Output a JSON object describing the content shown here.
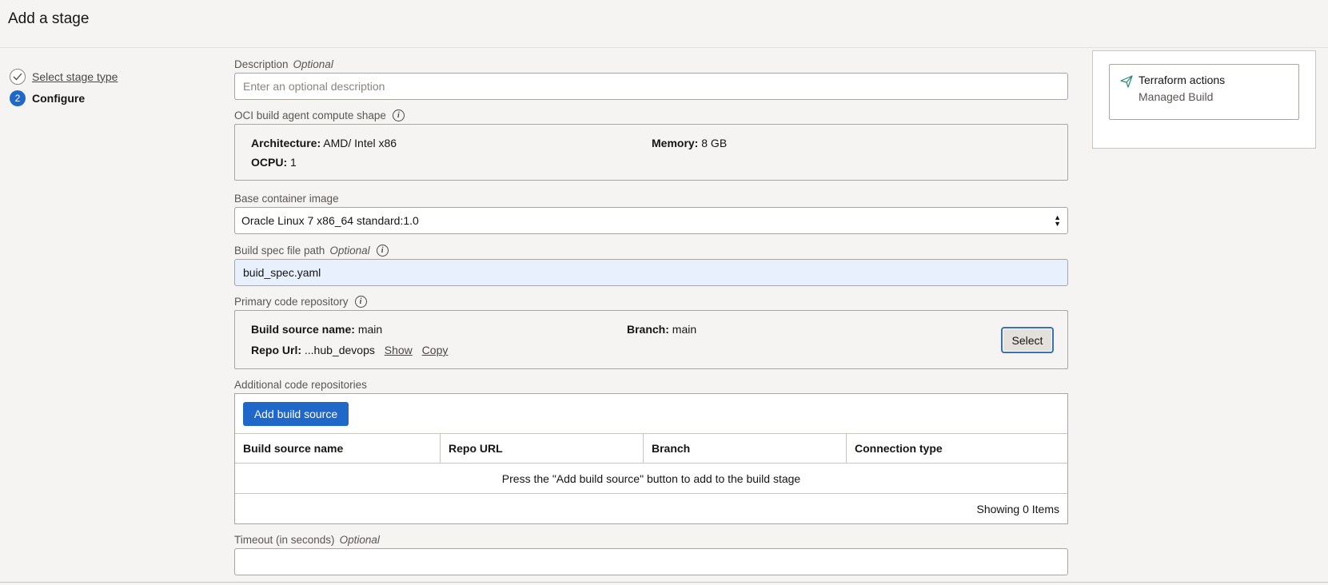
{
  "header": {
    "title": "Add a stage"
  },
  "steps": [
    {
      "number": "",
      "label": "Select stage type"
    },
    {
      "number": "2",
      "label": "Configure"
    }
  ],
  "form": {
    "description": {
      "label": "Description",
      "optional": "Optional",
      "placeholder": "Enter an optional description"
    },
    "compute_shape": {
      "label": "OCI build agent compute shape",
      "architecture_label": "Architecture:",
      "architecture_value": "AMD/ Intel x86",
      "memory_label": "Memory:",
      "memory_value": "8 GB",
      "ocpu_label": "OCPU:",
      "ocpu_value": "1"
    },
    "base_image": {
      "label": "Base container image",
      "value": "Oracle Linux 7 x86_64 standard:1.0"
    },
    "build_spec": {
      "label": "Build spec file path",
      "optional": "Optional",
      "value": "buid_spec.yaml"
    },
    "primary_repo": {
      "label": "Primary code repository",
      "source_name_label": "Build source name:",
      "source_name_value": "main",
      "branch_label": "Branch:",
      "branch_value": "main",
      "repo_url_label": "Repo Url:",
      "repo_url_value": "...hub_devops",
      "show_link": "Show",
      "copy_link": "Copy",
      "select_button": "Select"
    },
    "additional_repos": {
      "label": "Additional code repositories",
      "add_button": "Add build source",
      "columns": [
        "Build source name",
        "Repo URL",
        "Branch",
        "Connection type"
      ],
      "empty_message": "Press the \"Add build source\" button to add to the build stage",
      "footer": "Showing 0 Items"
    },
    "timeout": {
      "label": "Timeout (in seconds)",
      "optional": "Optional",
      "value": ""
    }
  },
  "side_panel": {
    "title": "Terraform actions",
    "subtitle": "Managed Build",
    "icon": "send-icon"
  }
}
